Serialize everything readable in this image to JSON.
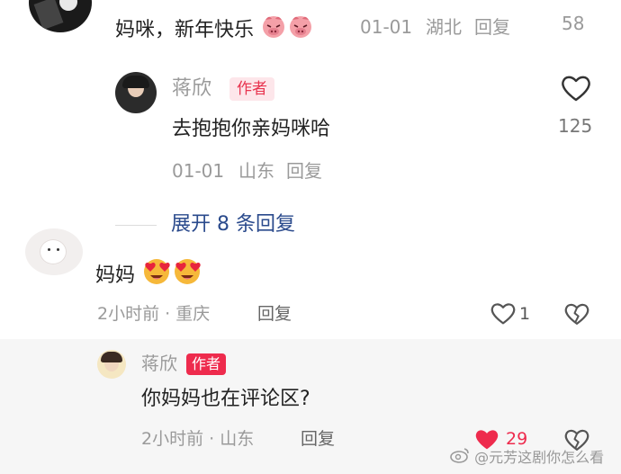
{
  "top_comment": {
    "text": "妈咪，新年快乐",
    "date": "01-01",
    "location": "湖北",
    "reply_label": "回复",
    "like_count": "58"
  },
  "author_reply_1": {
    "username": "蒋欣",
    "author_tag": "作者",
    "text": "去抱抱你亲妈咪哈",
    "date": "01-01",
    "location": "山东",
    "reply_label": "回复",
    "like_count": "125"
  },
  "expand_link": {
    "label": "展开 8 条回复"
  },
  "comment_2": {
    "text": "妈妈",
    "time": "2小时前",
    "location": "重庆",
    "reply_label": "回复",
    "like_count": "1"
  },
  "author_reply_2": {
    "username": "蒋欣",
    "author_tag": "作者",
    "text": "你妈妈也在评论区?",
    "time": "2小时前",
    "location": "山东",
    "reply_label": "回复",
    "like_count": "29"
  },
  "watermark": {
    "text": "@元芳这剧你怎么看"
  },
  "colors": {
    "accent_red": "#ee2b4d",
    "link_blue": "#2a4a8c",
    "muted": "#9a9a9a"
  },
  "icons": [
    "heart-outline-icon",
    "heart-filled-icon",
    "broken-heart-icon",
    "smiling-face-heart-eyes-icon",
    "pig-face-emoji-icon"
  ]
}
